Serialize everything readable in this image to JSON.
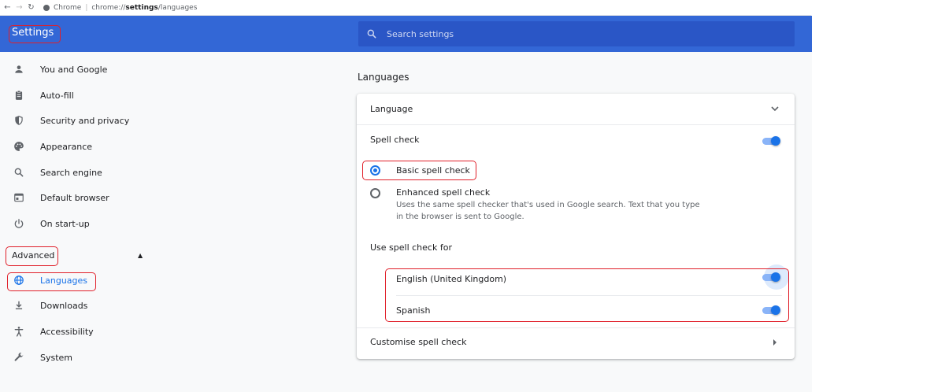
{
  "browser": {
    "site_label": "Chrome",
    "separator": "|",
    "url_prefix": "chrome://",
    "url_bold": "settings",
    "url_suffix": "/languages"
  },
  "header": {
    "title": "Settings",
    "search_placeholder": "Search settings"
  },
  "sidebar": {
    "items": [
      {
        "label": "You and Google",
        "icon": "person-icon"
      },
      {
        "label": "Auto-fill",
        "icon": "clipboard-icon"
      },
      {
        "label": "Security and privacy",
        "icon": "shield-icon"
      },
      {
        "label": "Appearance",
        "icon": "palette-icon"
      },
      {
        "label": "Search engine",
        "icon": "search-icon"
      },
      {
        "label": "Default browser",
        "icon": "browser-window-icon"
      },
      {
        "label": "On start-up",
        "icon": "power-icon"
      }
    ],
    "advanced_label": "Advanced",
    "advanced_items": [
      {
        "label": "Languages",
        "icon": "globe-icon",
        "active": true
      },
      {
        "label": "Downloads",
        "icon": "download-icon"
      },
      {
        "label": "Accessibility",
        "icon": "accessibility-icon"
      },
      {
        "label": "System",
        "icon": "wrench-icon"
      }
    ]
  },
  "main": {
    "section_title": "Languages",
    "language_row": "Language",
    "spell_check_label": "Spell check",
    "spell_check_on": true,
    "basic_spell_check": "Basic spell check",
    "enhanced_spell_check": "Enhanced spell check",
    "enhanced_description_line1": "Uses the same spell checker that's used in Google search. Text that you type",
    "enhanced_description_line2": "in the browser is sent to Google.",
    "selected_mode": "basic",
    "use_spell_check_for": "Use spell check for",
    "languages": [
      {
        "name": "English (United Kingdom)",
        "enabled": true
      },
      {
        "name": "Spanish",
        "enabled": true
      }
    ],
    "customise_label": "Customise spell check"
  },
  "colors": {
    "header_blue": "#3367d6",
    "accent": "#1a73e8",
    "annotation_red": "#e0202a"
  }
}
